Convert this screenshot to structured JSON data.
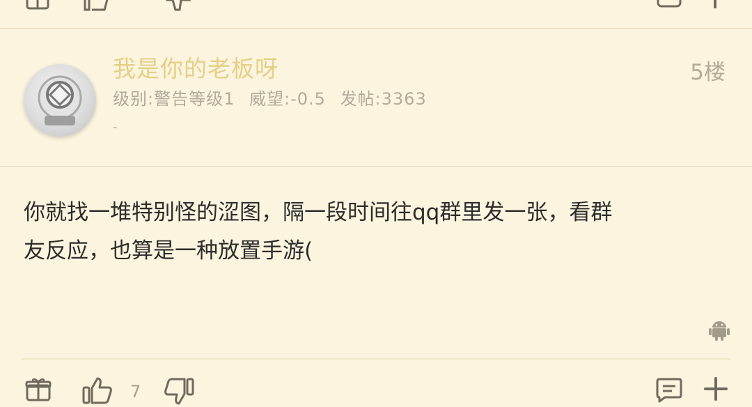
{
  "post": {
    "author": "我是你的老板呀",
    "floor": "5楼",
    "meta": {
      "level": "级别:警告等级1",
      "prestige": "威望:-0.5",
      "posts": "发帖:3363"
    },
    "signature": "-",
    "content_lines": [
      "你就找一堆特别怪的涩图，隔一段时间往qq群里发一张，看群",
      "友反应，也算是一种放置手游("
    ],
    "like_count": "7"
  },
  "icons": {
    "gift": "gift-icon",
    "like": "thumbs-up-icon",
    "dislike": "thumbs-down-icon",
    "comment": "comment-icon",
    "more": "plus-icon",
    "client": "android-icon",
    "avatar": "diving-helmet-avatar"
  },
  "colors": {
    "background": "#fbf4de",
    "author": "#e6cf86",
    "meta": "#b1ab9c",
    "icon": "#6f6a5e"
  }
}
